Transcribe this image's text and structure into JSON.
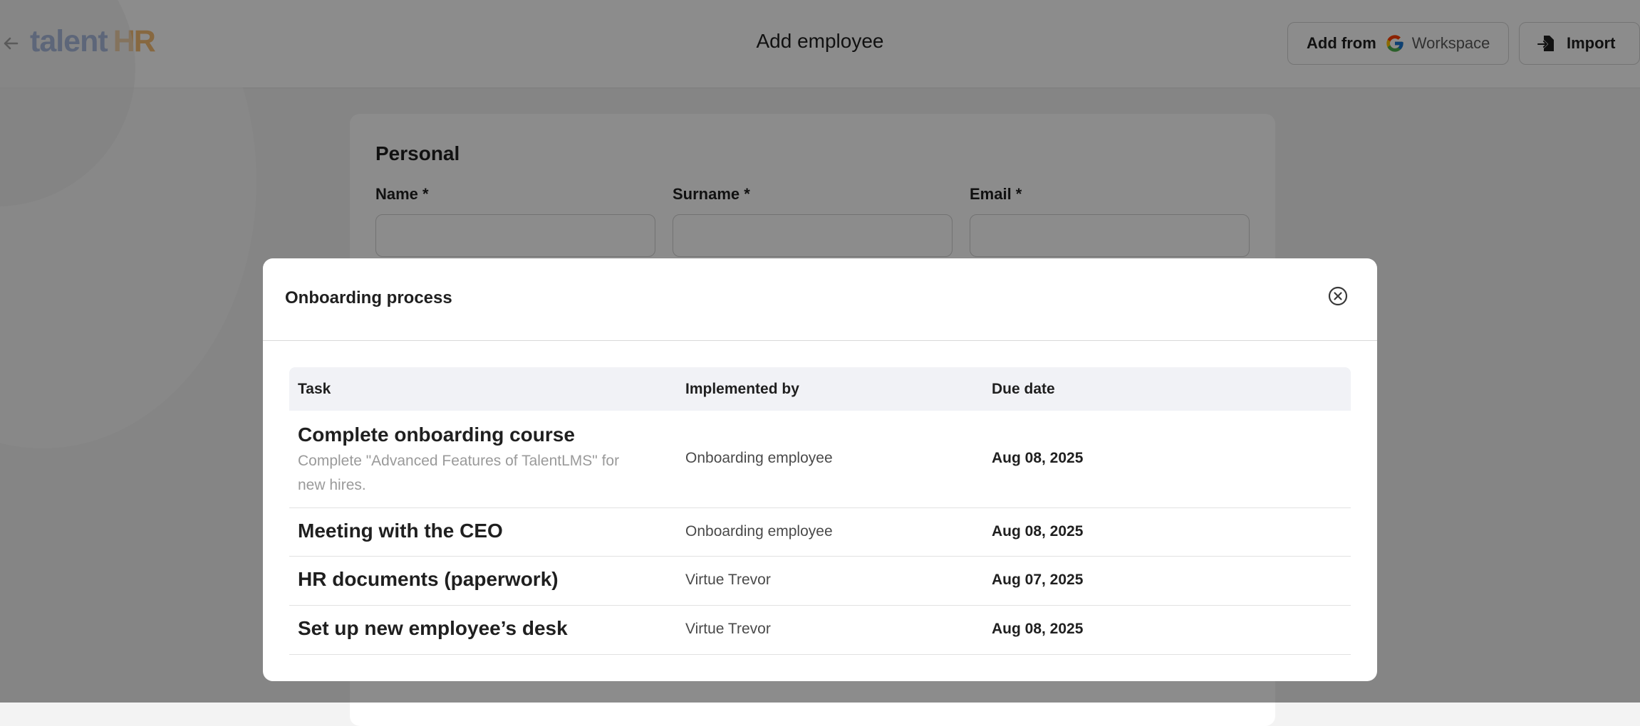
{
  "header": {
    "logo_talent": "talent",
    "logo_hr": "HR",
    "title": "Add employee",
    "add_from_label": "Add from",
    "workspace_label": "Workspace",
    "import_label": "Import"
  },
  "form": {
    "section_title": "Personal",
    "name_label": "Name *",
    "surname_label": "Surname *",
    "email_label": "Email *"
  },
  "modal": {
    "title": "Onboarding process",
    "columns": {
      "task": "Task",
      "implemented_by": "Implemented by",
      "due_date": "Due date"
    },
    "rows": [
      {
        "title": "Complete onboarding course",
        "description": "Complete \"Advanced Features of TalentLMS\" for new hires.",
        "implemented_by": "Onboarding employee",
        "due_date": "Aug 08, 2025"
      },
      {
        "title": "Meeting with the CEO",
        "implemented_by": "Onboarding employee",
        "due_date": "Aug 08, 2025"
      },
      {
        "title": "HR documents (paperwork)",
        "implemented_by": "Virtue Trevor",
        "due_date": "Aug 07, 2025"
      },
      {
        "title": "Set up new employee’s desk",
        "implemented_by": "Virtue Trevor",
        "due_date": "Aug 08, 2025"
      }
    ]
  },
  "icons": {
    "back": "arrow-left-icon",
    "google": "google-g-icon",
    "import": "file-import-icon",
    "close": "close-circle-icon"
  },
  "colors": {
    "brand_blue": "#2b5db8",
    "brand_orange": "#f19a2b",
    "overlay": "rgba(0,0,0,0.45)"
  }
}
